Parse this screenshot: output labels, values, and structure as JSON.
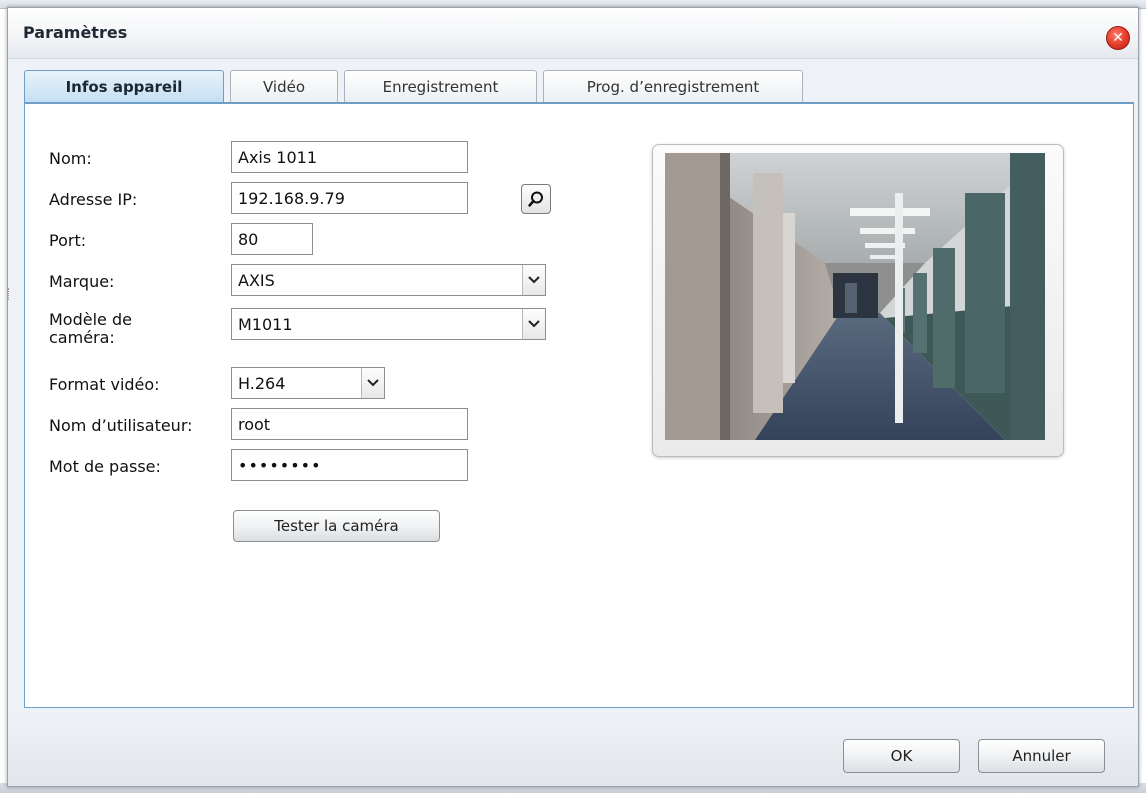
{
  "dialog": {
    "title": "Paramètres"
  },
  "tabs": [
    {
      "label": "Infos appareil",
      "active": true
    },
    {
      "label": "Vidéo",
      "active": false
    },
    {
      "label": "Enregistrement",
      "active": false
    },
    {
      "label": "Prog. d’enregistrement",
      "active": false
    }
  ],
  "form": {
    "name": {
      "label": "Nom:",
      "value": "Axis 1011"
    },
    "ip": {
      "label": "Adresse IP:",
      "value": "192.168.9.79"
    },
    "port": {
      "label": "Port:",
      "value": "80"
    },
    "brand": {
      "label": "Marque:",
      "value": "AXIS"
    },
    "model": {
      "label_line1": "Modèle de",
      "label_line2": "caméra:",
      "value": "M1011"
    },
    "video_format": {
      "label": "Format vidéo:",
      "value": "H.264"
    },
    "username": {
      "label": "Nom d’utilisateur:",
      "value": "root"
    },
    "password": {
      "label": "Mot de passe:",
      "value": "••••••••"
    },
    "test_button": "Tester la caméra"
  },
  "footer": {
    "ok_label": "OK",
    "cancel_label": "Annuler"
  },
  "icons": {
    "close": "close-icon",
    "search": "search-icon",
    "dropdown": "chevron-down-icon"
  },
  "colors": {
    "tab_accent": "#6f9ec7",
    "close_red": "#e23a2a"
  }
}
